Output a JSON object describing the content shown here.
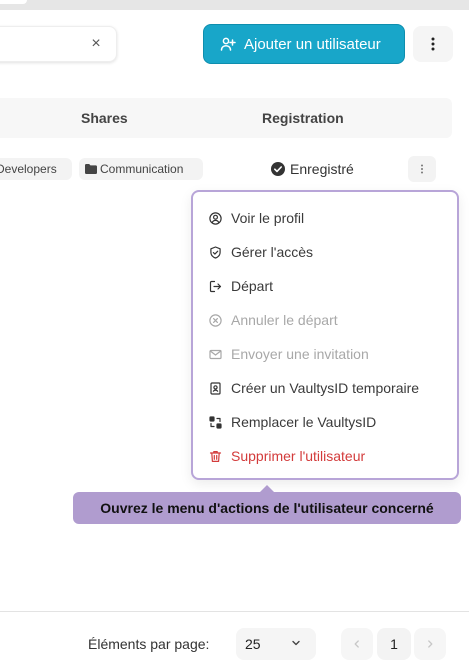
{
  "toolbar": {
    "search_clear_glyph": "×",
    "add_user_label": "Ajouter un utilisateur",
    "more_glyph": "⋮"
  },
  "table": {
    "columns": [
      "Shares",
      "Registration"
    ],
    "row": {
      "shares": [
        "Developers",
        "Communication"
      ],
      "registration": "Enregistré"
    }
  },
  "actions_menu": {
    "items": [
      {
        "label": "Voir le profil",
        "icon": "user-circle-icon",
        "state": "normal"
      },
      {
        "label": "Gérer l'accès",
        "icon": "shield-check-icon",
        "state": "normal"
      },
      {
        "label": "Départ",
        "icon": "logout-icon",
        "state": "normal"
      },
      {
        "label": "Annuler le départ",
        "icon": "x-circle-icon",
        "state": "disabled"
      },
      {
        "label": "Envoyer une invitation",
        "icon": "mail-icon",
        "state": "disabled"
      },
      {
        "label": "Créer un VaultysID temporaire",
        "icon": "id-card-icon",
        "state": "normal"
      },
      {
        "label": "Remplacer le VaultysID",
        "icon": "swap-icon",
        "state": "normal"
      },
      {
        "label": "Supprimer l'utilisateur",
        "icon": "trash-icon",
        "state": "danger"
      }
    ]
  },
  "tooltip": {
    "text": "Ouvrez le menu d'actions de l'utilisateur concerné"
  },
  "pagination": {
    "per_page_label": "Éléments par page:",
    "per_page_value": "25",
    "current_page": "1"
  },
  "colors": {
    "accent": "#18a6c9",
    "menu_border": "#b8a5d8",
    "tooltip_bg": "#b09ccf",
    "danger": "#d33b3b",
    "disabled": "#a8a8a8"
  }
}
